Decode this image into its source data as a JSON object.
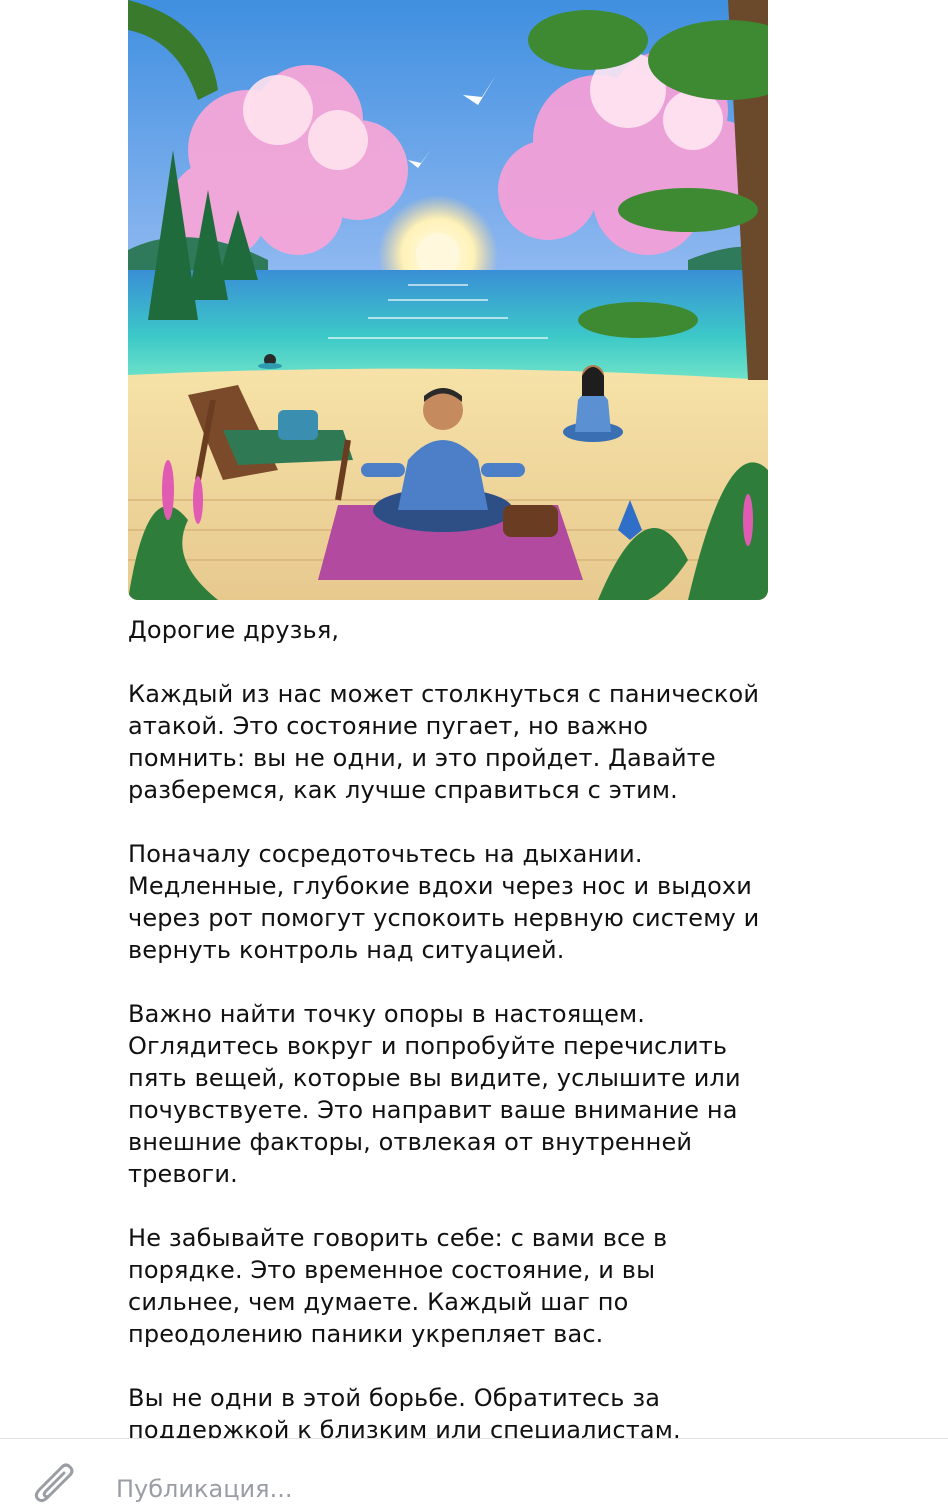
{
  "post": {
    "image": {
      "description_icon": "illustration-meditation-beach"
    },
    "paragraphs": [
      "Дорогие друзья,",
      "Каждый из нас может столкнуться с панической\nатакой. Это состояние пугает, но важно\nпомнить: вы не одни, и это пройдет. Давайте\nразберемся, как лучше справиться с этим.",
      "Поначалу сосредоточьтесь на дыхании.\nМедленные, глубокие вдохи через нос и выдохи\nчерез рот помогут успокоить нервную систему и\nвернуть контроль над ситуацией.",
      "Важно найти точку опоры в настоящем.\nОглядитесь вокруг и попробуйте перечислить\nпять вещей, которые вы видите, услышите или\nпочувствуете. Это направит ваше внимание на\nвнешние факторы, отвлекая от внутренней\nтревоги.",
      "Не забывайте говорить себе: с вами все в\nпорядке. Это временное состояние, и вы\nсильнее, чем думаете. Каждый шаг по\nпреодолению паники укрепляет вас.",
      "Вы не одни в этой борьбе. Обратитесь за\nподдержкой к близким или специалистам."
    ]
  },
  "composer": {
    "placeholder": "Публикация...",
    "value": "",
    "attach_icon": "paperclip-icon"
  },
  "colors": {
    "text": "#111111",
    "placeholder": "#9a9da3",
    "divider": "#e3e4e8",
    "icon": "#9a9da3"
  }
}
